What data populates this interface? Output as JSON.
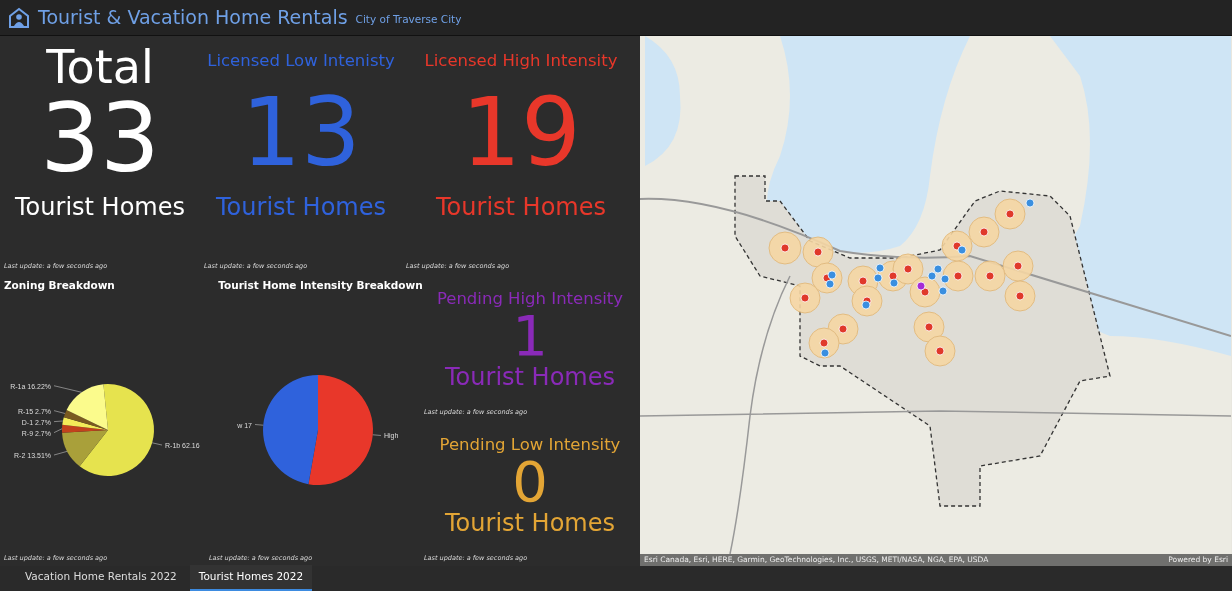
{
  "header": {
    "title": "Tourist & Vacation Home Rentals",
    "subtitle": "City of Traverse City"
  },
  "indicators": [
    {
      "kind": "headline",
      "title": "Total",
      "value": "33",
      "subtitle": "Tourist Homes",
      "color": "#ffffff",
      "last_update": "Last update: a few seconds ago"
    },
    {
      "kind": "titled",
      "title": "Licensed Low Intenisty",
      "value": "13",
      "subtitle": "Tourist Homes",
      "color": "#2f62dc",
      "last_update": "Last update: a few seconds ago"
    },
    {
      "kind": "titled",
      "title": "Licensed High Intensity",
      "value": "19",
      "subtitle": "Tourist Homes",
      "color": "#e8372a",
      "last_update": "Last update: a few seconds ago"
    }
  ],
  "charts": [
    {
      "title": "Zoning Breakdown",
      "last_update": "Last update: a few seconds ago",
      "chart_data": {
        "type": "pie",
        "categories": [
          "R-1b",
          "R-2",
          "R-9",
          "D-1",
          "R-15",
          "R-1a"
        ],
        "values": [
          62.16,
          13.51,
          2.7,
          2.7,
          2.7,
          16.22
        ],
        "colors": [
          "#e6e34e",
          "#a9a03a",
          "#c2421c",
          "#f4ec58",
          "#7a5a20",
          "#fbfb8c"
        ],
        "value_labels": [
          "62.16",
          "13.51%",
          "2.7%",
          "2.7%",
          "2.7%",
          "16.22%"
        ]
      }
    },
    {
      "title": "Tourist Home Intensity Breakdown",
      "last_update": "Last update: a few seconds ago",
      "chart_data": {
        "type": "pie",
        "categories": [
          "High",
          "w"
        ],
        "values": [
          19,
          17
        ],
        "colors": [
          "#e8372a",
          "#2f62dc"
        ],
        "value_labels": [
          null,
          "17"
        ]
      }
    }
  ],
  "pending": [
    {
      "kind": "titled",
      "title": "Pending High Intensity",
      "value": "1",
      "subtitle": "Tourist Homes",
      "color": "#8a2ab8",
      "last_update": "Last update: a few seconds ago"
    },
    {
      "kind": "titled",
      "title": "Pending Low Intensity",
      "value": "0",
      "subtitle": "Tourist Homes",
      "color": "#e3a535",
      "last_update": "Last update: a few seconds ago"
    }
  ],
  "map": {
    "attribution": "Esri Canada, Esri, HERE, Garmin, GeoTechnologies, Inc., USGS, METI/NASA, NGA, EPA, USDA",
    "powered_by": "Powered by Esri"
  },
  "tabs": [
    {
      "label": "Vacation Home Rentals 2022",
      "selected": false
    },
    {
      "label": "Tourist Homes 2022",
      "selected": true
    }
  ]
}
